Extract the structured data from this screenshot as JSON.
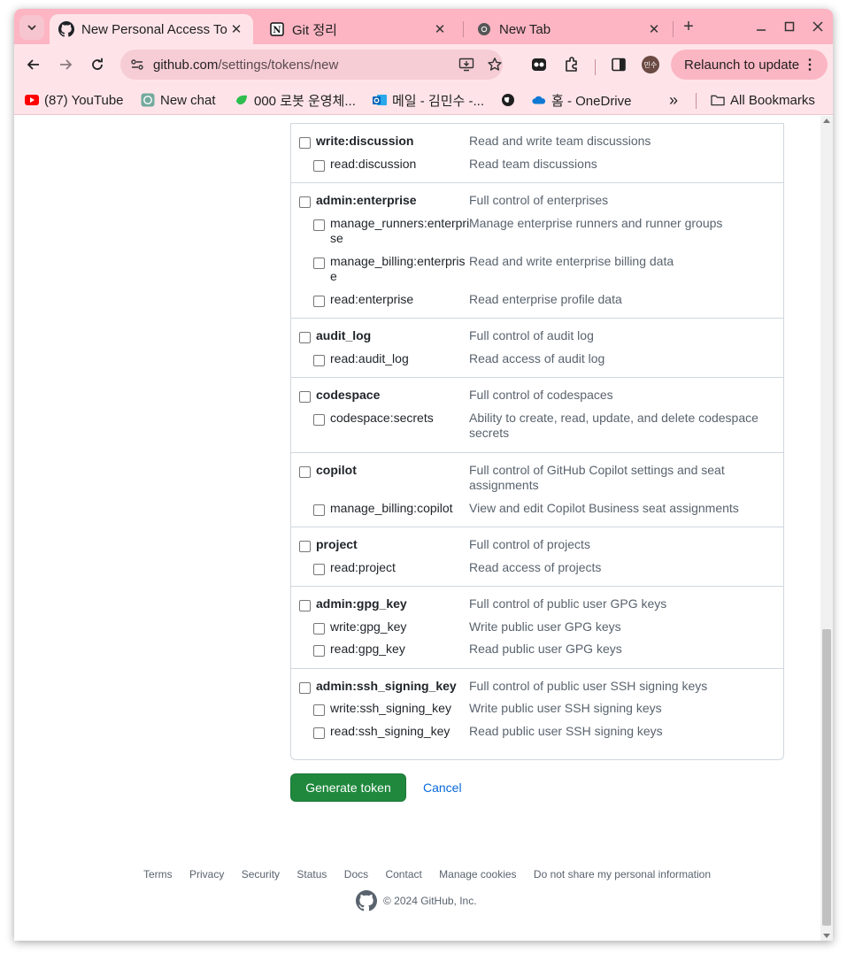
{
  "browser": {
    "tabs": [
      {
        "title": "New Personal Access To",
        "favicon": "github-icon",
        "active": true
      },
      {
        "title": "Git 정리",
        "favicon": "notion-icon",
        "active": false
      },
      {
        "title": "New Tab",
        "favicon": "chrome-icon",
        "active": false
      }
    ],
    "url_host": "github.com",
    "url_path": "/settings/tokens/new",
    "profile_initials": "민수",
    "relaunch_label": "Relaunch to update",
    "bookmarks": [
      {
        "label": "(87) YouTube",
        "icon": "youtube-icon"
      },
      {
        "label": "New chat",
        "icon": "chatgpt-icon"
      },
      {
        "label": "000 로봇 운영체...",
        "icon": "leaf-icon"
      },
      {
        "label": "메일 - 김민수 -...",
        "icon": "outlook-icon"
      },
      {
        "label": "",
        "icon": "globe-icon"
      },
      {
        "label": "홈 - OneDrive",
        "icon": "onedrive-icon"
      }
    ],
    "bookmarks_more": "»",
    "all_bookmarks_label": "All Bookmarks"
  },
  "scope_groups": [
    {
      "scopes": [
        {
          "name": "write:discussion",
          "desc": "Read and write team discussions",
          "parent": true
        },
        {
          "name": "read:discussion",
          "desc": "Read team discussions",
          "parent": false
        }
      ]
    },
    {
      "scopes": [
        {
          "name": "admin:enterprise",
          "desc": "Full control of enterprises",
          "parent": true
        },
        {
          "name": "manage_runners:enterpri se",
          "desc": "Manage enterprise runners and runner groups",
          "parent": false
        },
        {
          "name": "manage_billing:enterpris e",
          "desc": "Read and write enterprise billing data",
          "parent": false
        },
        {
          "name": "read:enterprise",
          "desc": "Read enterprise profile data",
          "parent": false
        }
      ]
    },
    {
      "scopes": [
        {
          "name": "audit_log",
          "desc": "Full control of audit log",
          "parent": true
        },
        {
          "name": "read:audit_log",
          "desc": "Read access of audit log",
          "parent": false
        }
      ]
    },
    {
      "scopes": [
        {
          "name": "codespace",
          "desc": "Full control of codespaces",
          "parent": true
        },
        {
          "name": "codespace:secrets",
          "desc": "Ability to create, read, update, and delete codespace secrets",
          "parent": false
        }
      ]
    },
    {
      "scopes": [
        {
          "name": "copilot",
          "desc": "Full control of GitHub Copilot settings and seat assignments",
          "parent": true
        },
        {
          "name": "manage_billing:copilot",
          "desc": "View and edit Copilot Business seat assignments",
          "parent": false
        }
      ]
    },
    {
      "scopes": [
        {
          "name": "project",
          "desc": "Full control of projects",
          "parent": true
        },
        {
          "name": "read:project",
          "desc": "Read access of projects",
          "parent": false
        }
      ]
    },
    {
      "scopes": [
        {
          "name": "admin:gpg_key",
          "desc": "Full control of public user GPG keys",
          "parent": true
        },
        {
          "name": "write:gpg_key",
          "desc": "Write public user GPG keys",
          "parent": false
        },
        {
          "name": "read:gpg_key",
          "desc": "Read public user GPG keys",
          "parent": false
        }
      ]
    },
    {
      "scopes": [
        {
          "name": "admin:ssh_signing_key",
          "desc": "Full control of public user SSH signing keys",
          "parent": true
        },
        {
          "name": "write:ssh_signing_key",
          "desc": "Write public user SSH signing keys",
          "parent": false
        },
        {
          "name": "read:ssh_signing_key",
          "desc": "Read public user SSH signing keys",
          "parent": false
        }
      ]
    }
  ],
  "actions": {
    "generate_label": "Generate token",
    "cancel_label": "Cancel"
  },
  "footer": {
    "links": [
      "Terms",
      "Privacy",
      "Security",
      "Status",
      "Docs",
      "Contact",
      "Manage cookies",
      "Do not share my personal information"
    ],
    "copyright": "© 2024 GitHub, Inc."
  },
  "colors": {
    "tabstrip": "#fdb5c3",
    "toolbar": "#fee4e9",
    "generate_button": "#1f883d",
    "link": "#0969da"
  }
}
